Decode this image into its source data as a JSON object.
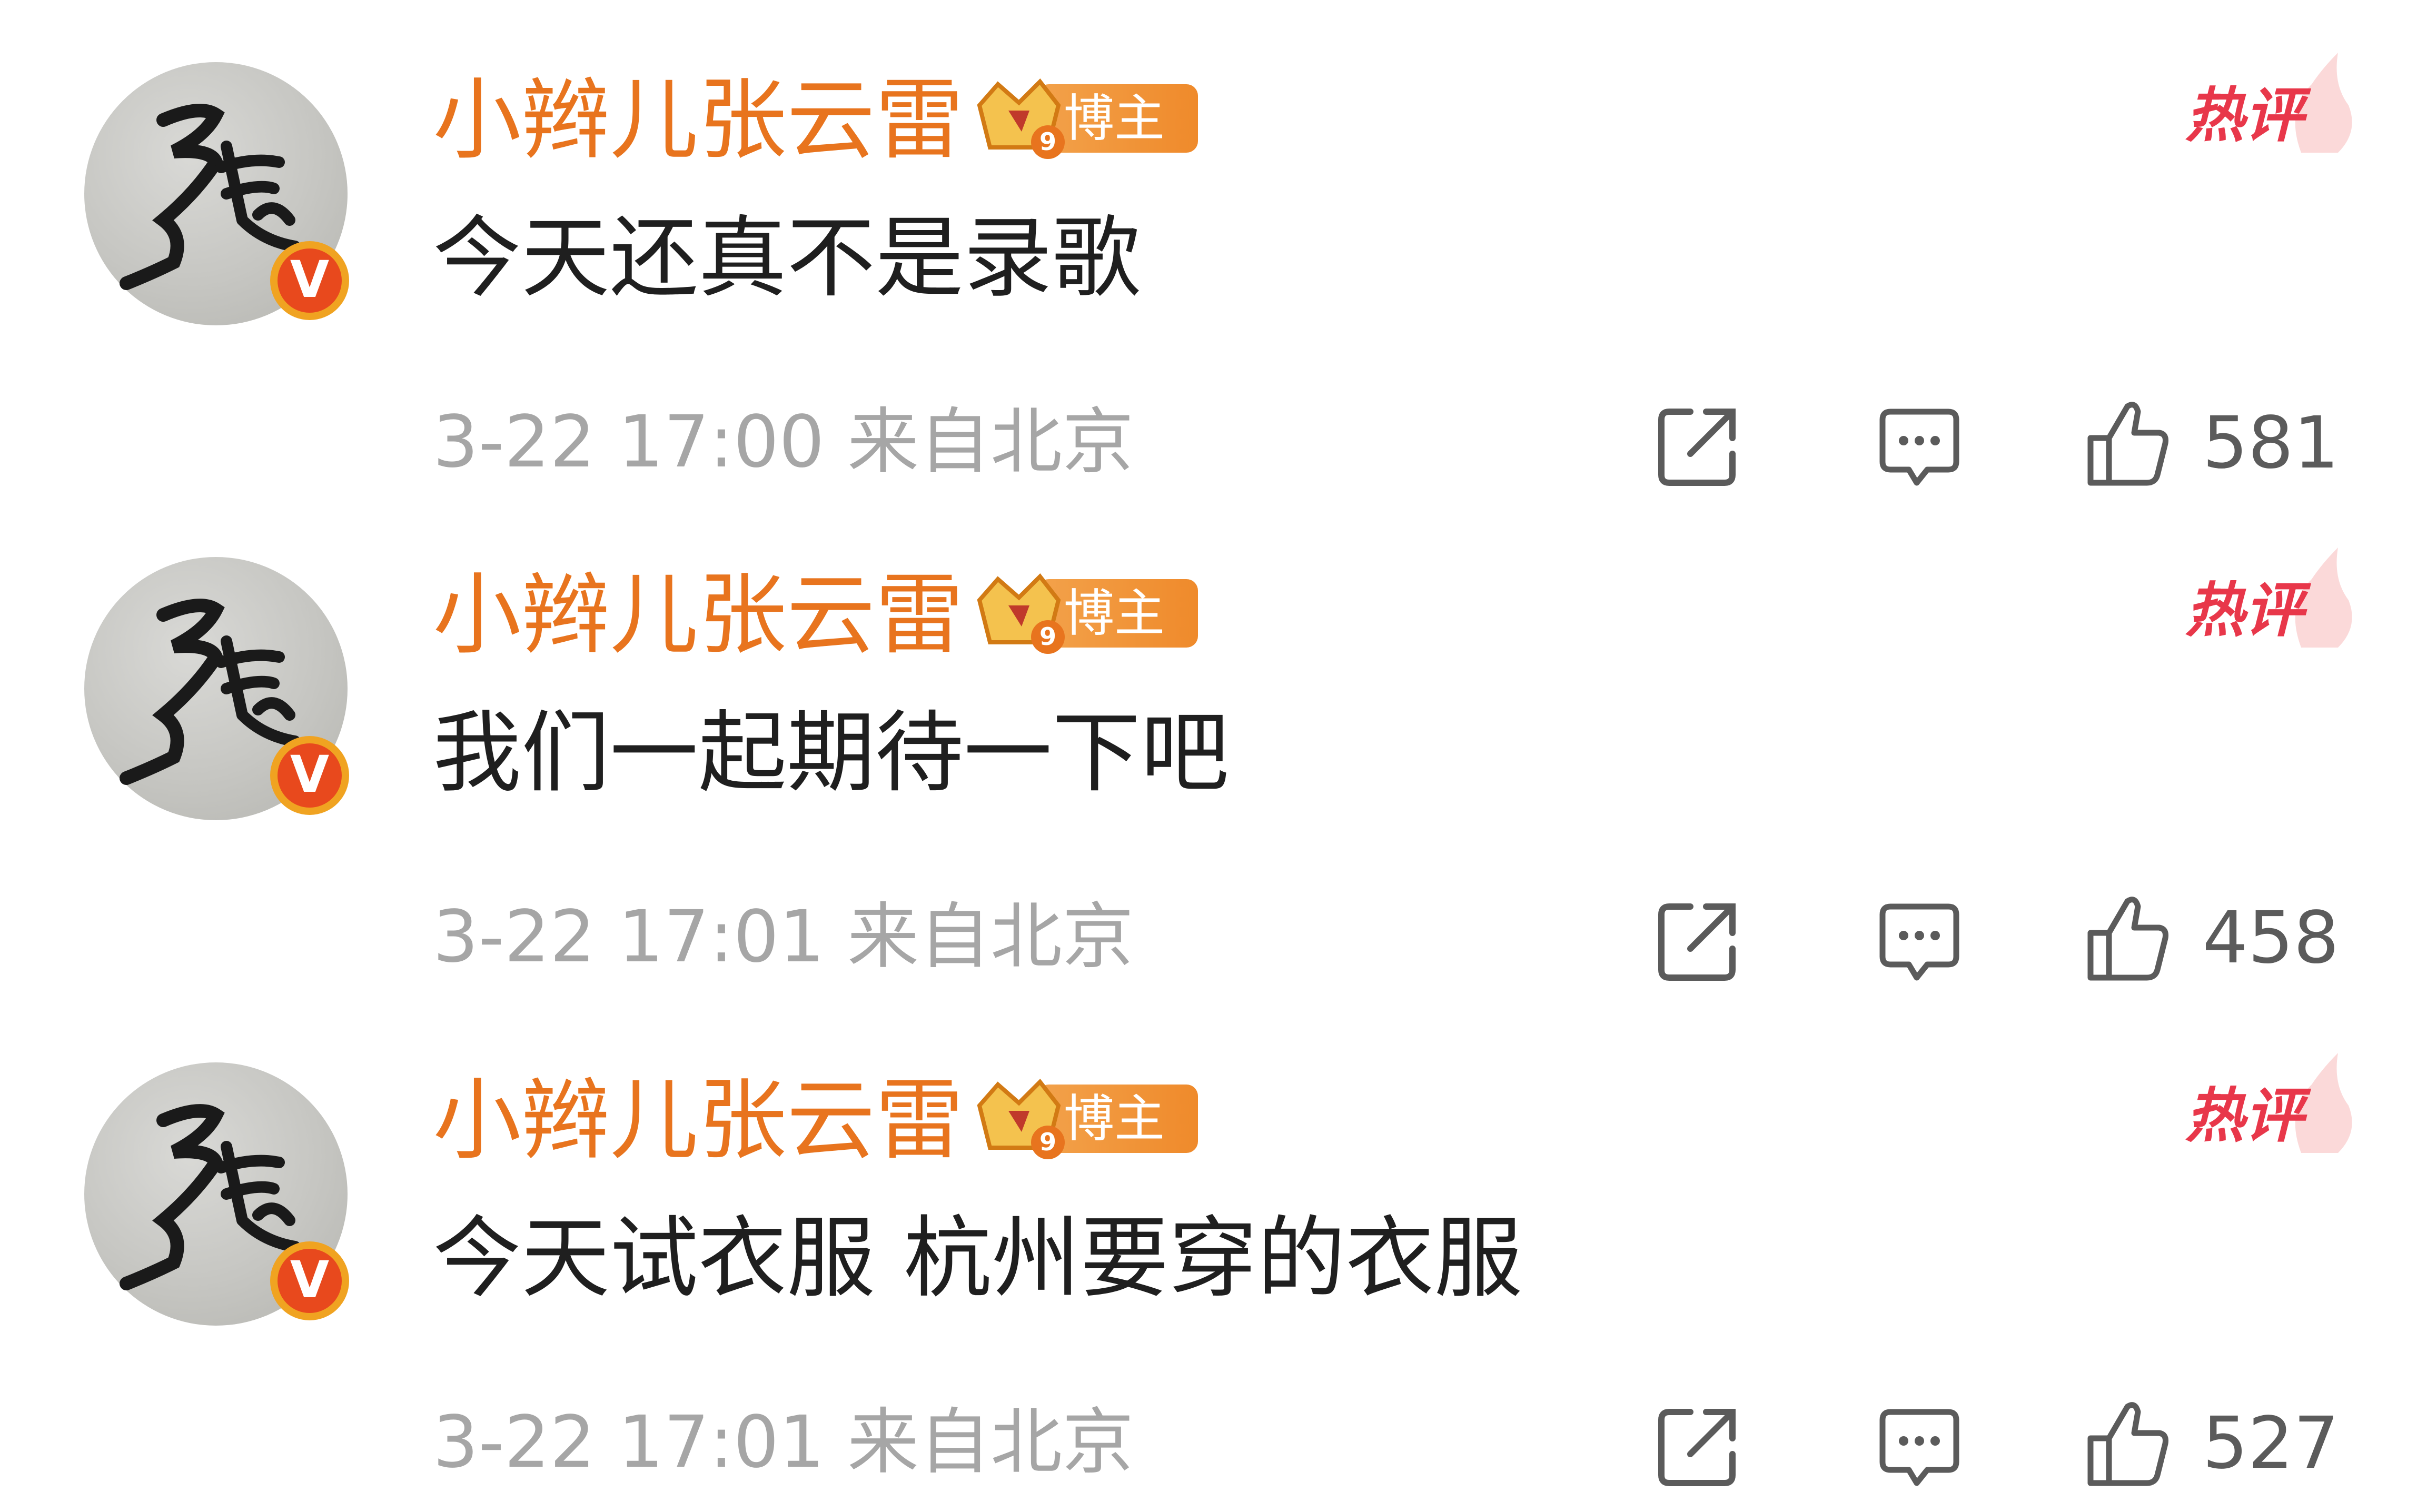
{
  "colors": {
    "username": "#e8741e",
    "content": "#1f1f1f",
    "meta": "#a6a6a6",
    "icon": "#5b5b5b",
    "hot": "#e8374a",
    "vbadge_outer": "#f0a321",
    "vbadge_inner": "#e8491d",
    "rank_badge": "#ef8a2b"
  },
  "icons": {
    "share": "share-icon",
    "comment": "comment-icon",
    "like": "thumbs-up-icon",
    "verified": "verified-v-icon",
    "rank": "crown-rank-icon",
    "hot": "hot-flame-icon"
  },
  "comments": [
    {
      "username": "小辫儿张云雷",
      "rank_label": "博主",
      "rank_level": "9",
      "verified_label": "V",
      "hot_label": "热评",
      "content": "今天还真不是录歌",
      "meta": "3-22 17:00  来自北京",
      "likes": "581"
    },
    {
      "username": "小辫儿张云雷",
      "rank_label": "博主",
      "rank_level": "9",
      "verified_label": "V",
      "hot_label": "热评",
      "content": "我们一起期待一下吧",
      "meta": "3-22 17:01  来自北京",
      "likes": "458"
    },
    {
      "username": "小辫儿张云雷",
      "rank_label": "博主",
      "rank_level": "9",
      "verified_label": "V",
      "hot_label": "热评",
      "content": "今天试衣服 杭州要穿的衣服",
      "meta": "3-22 17:01  来自北京",
      "likes": "527"
    }
  ]
}
